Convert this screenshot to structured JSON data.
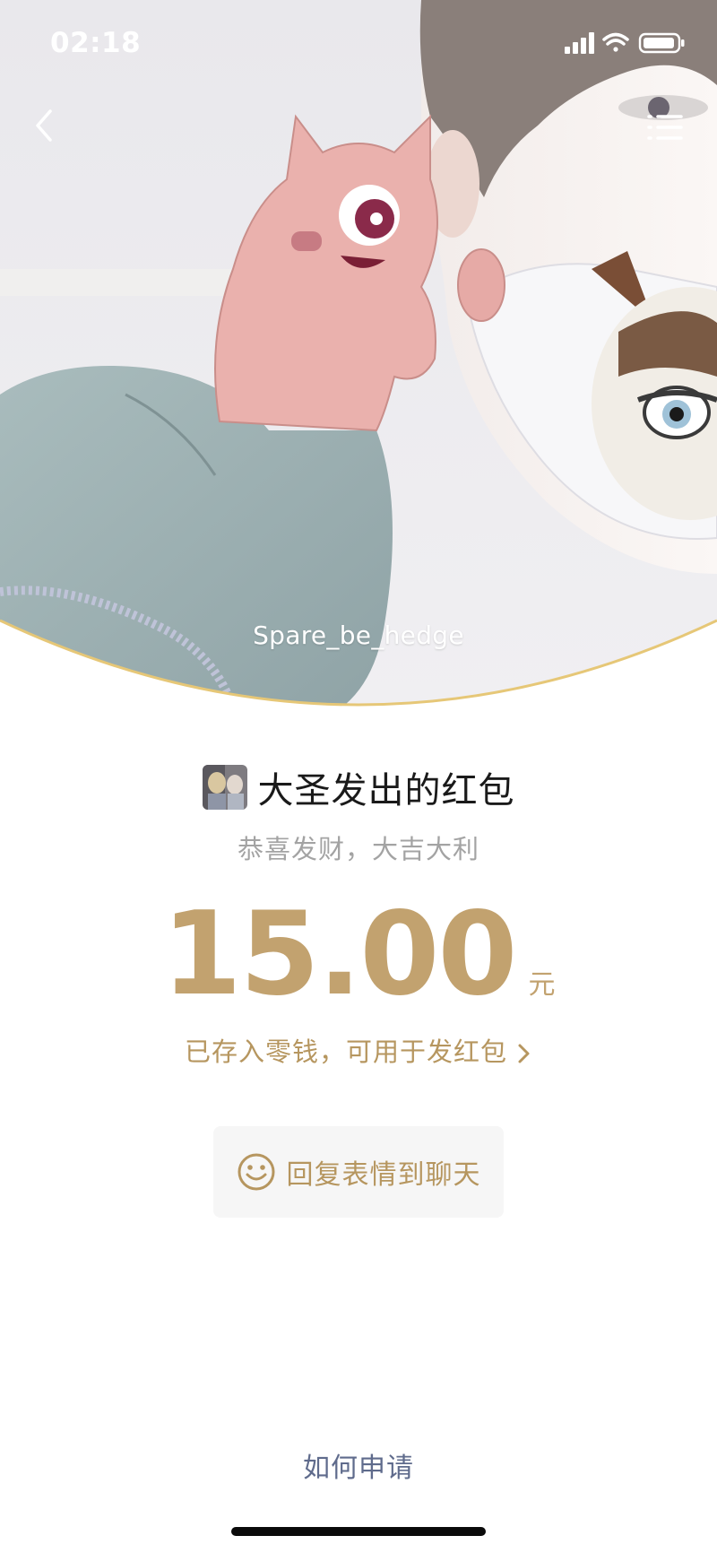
{
  "status_bar": {
    "time": "02:18"
  },
  "header": {
    "cover_name": "Spare_be_hedge"
  },
  "packet": {
    "sender_title": "大圣发出的红包",
    "blessing": "恭喜发财，大吉大利",
    "amount": "15.00",
    "unit": "元",
    "saved_note": "已存入零钱，可用于发红包"
  },
  "actions": {
    "reply_label": "回复表情到聊天",
    "howto_label": "如何申请"
  },
  "colors": {
    "gold": "#c2a26f",
    "gold_text": "#b6965f",
    "link_blue": "#5f6b8c",
    "gray_text": "#a3a3a3"
  },
  "icons": {
    "back": "back-chevron-icon",
    "menu": "menu-list-icon",
    "reply": "smiley-face-icon",
    "saved_chevron": "chevron-right-icon"
  }
}
